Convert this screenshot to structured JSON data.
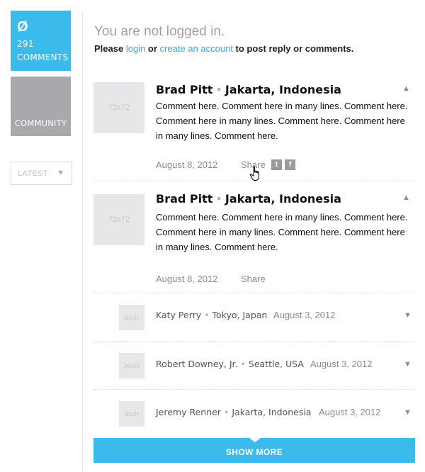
{
  "sidebar": {
    "comments_tile": {
      "logo": "Ø",
      "count": "291",
      "label": "COMMENTS"
    },
    "community_tile": {
      "label": "COMMUNITY"
    },
    "sort": {
      "value": "LATEST",
      "arrow": "▼"
    }
  },
  "header": {
    "notice": "You are not logged in.",
    "prefix": "Please",
    "login_link": "login",
    "or": "or",
    "create_link": "create an account",
    "suffix": "to post reply or comments."
  },
  "comments": [
    {
      "avatar": "72x72",
      "name": "Brad Pitt",
      "sep": "•",
      "location": "Jakarta, Indonesia",
      "body": "Comment here. Comment here in many lines. Comment here. Comment here in many lines. Comment here. Comment here in many lines. Comment here.",
      "date": "August 8, 2012",
      "share": "Share",
      "caret": "▲"
    },
    {
      "avatar": "72x72",
      "name": "Brad Pitt",
      "sep": "•",
      "location": "Jakarta, Indonesia",
      "body": "Comment here. Comment here in many lines. Comment here. Comment here in many lines. Comment here. Comment here in many lines. Comment here.",
      "date": "August 8, 2012",
      "share": "Share",
      "caret": "▲"
    }
  ],
  "replies": [
    {
      "avatar": "36x36",
      "name": "Katy Perry",
      "sep": "•",
      "location": "Tokyo, Japan",
      "date": "August 3, 2012",
      "caret": "▼"
    },
    {
      "avatar": "36x36",
      "name": "Robert Downey, Jr.",
      "sep": "•",
      "location": "Seattle, USA",
      "date": "August 3, 2012",
      "caret": "▼"
    },
    {
      "avatar": "36x36",
      "name": "Jeremy Renner",
      "sep": "•",
      "location": "Jakarta, Indonesia",
      "date": "August 3, 2012",
      "caret": "▼"
    }
  ],
  "social": {
    "twitter": "t",
    "facebook": "f"
  },
  "show_more": "SHOW MORE",
  "colors": {
    "accent": "#3bbbec",
    "link": "#34a9d9",
    "tile_gray": "#a7a9ac"
  }
}
